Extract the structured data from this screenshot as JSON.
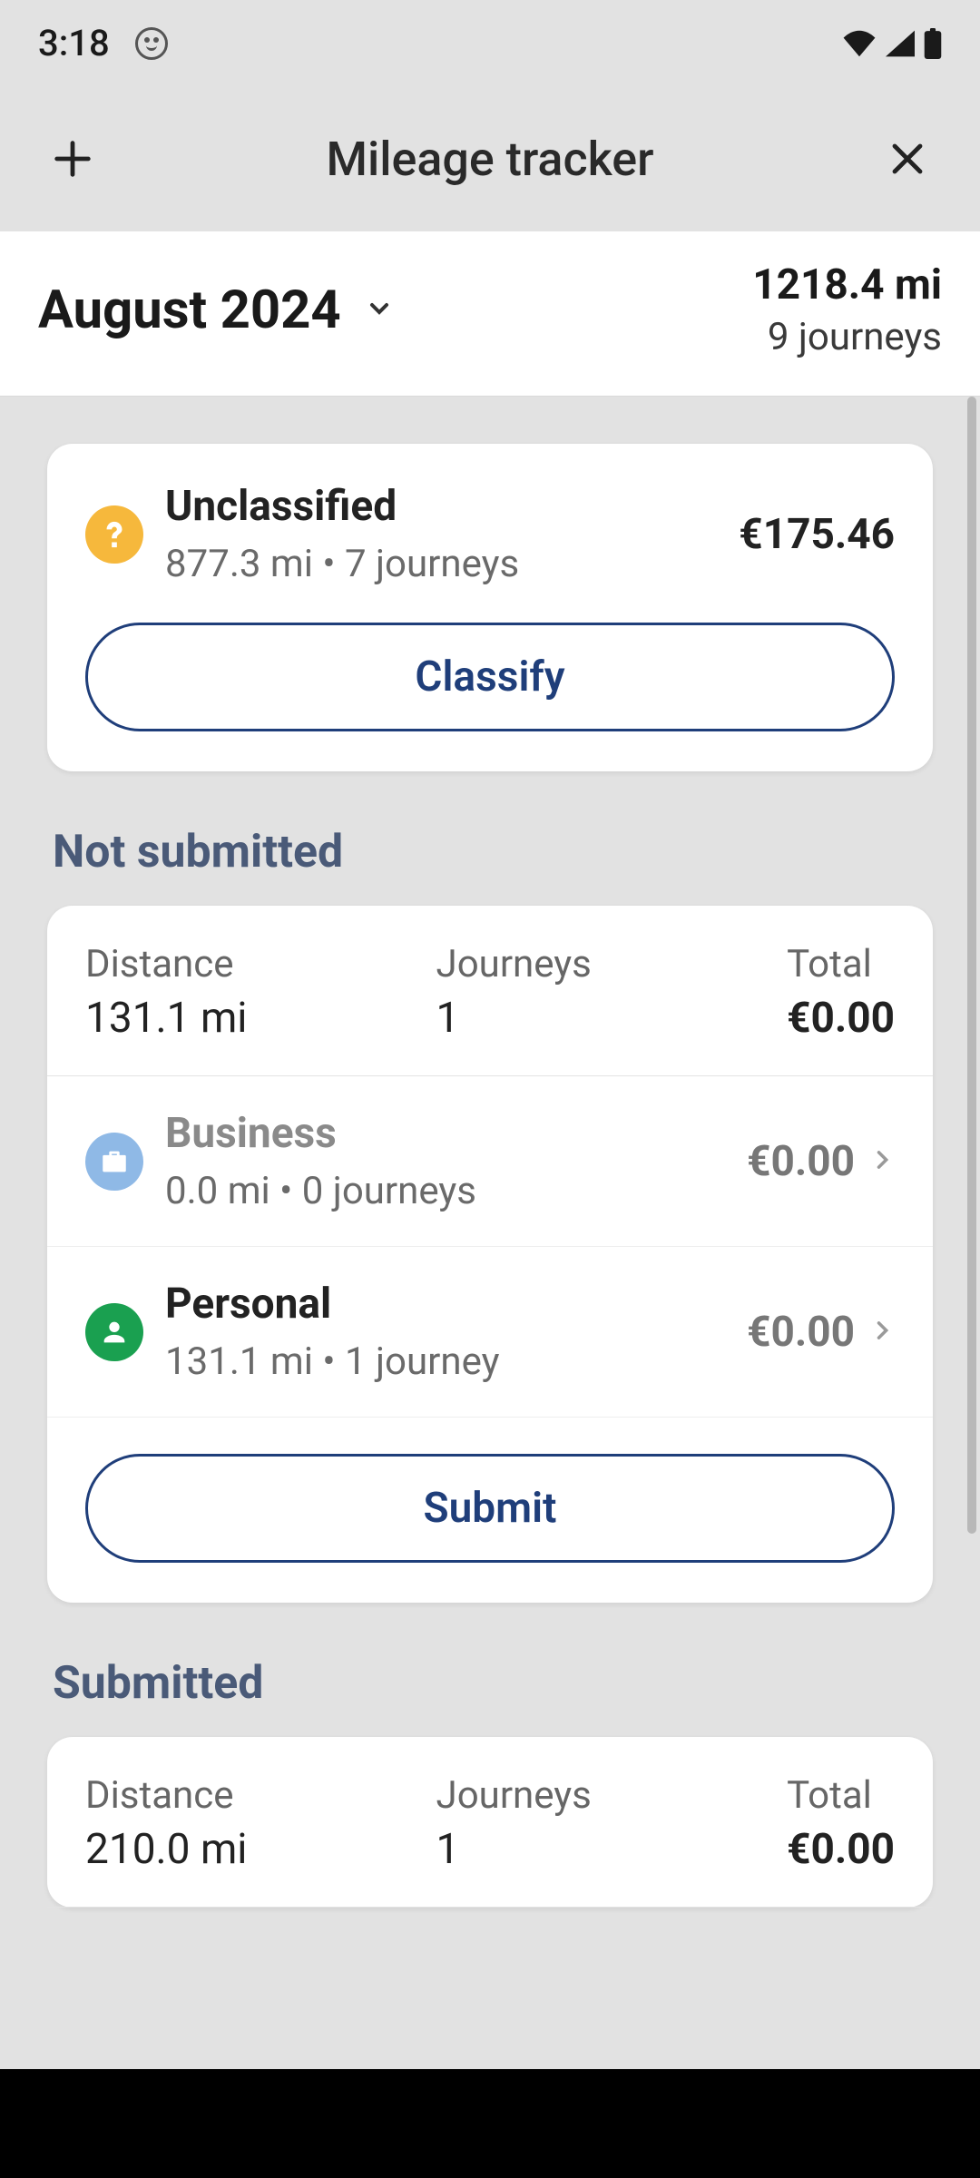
{
  "statusbar": {
    "time": "3:18"
  },
  "topbar": {
    "title": "Mileage tracker"
  },
  "summary": {
    "month": "August 2024",
    "total_distance": "1218.4 mi",
    "total_journeys": "9 journeys"
  },
  "unclassified": {
    "title": "Unclassified",
    "sub": "877.3 mi • 7 journeys",
    "amount": "€175.46",
    "button": "Classify"
  },
  "sections": {
    "not_submitted": {
      "heading": "Not submitted",
      "stats": {
        "distance_label": "Distance",
        "distance_value": "131.1 mi",
        "journeys_label": "Journeys",
        "journeys_value": "1",
        "total_label": "Total",
        "total_value": "€0.00"
      },
      "categories": [
        {
          "name": "Business",
          "sub": "0.0 mi • 0 journeys",
          "amount": "€0.00",
          "icon": "briefcase",
          "muted": true
        },
        {
          "name": "Personal",
          "sub": "131.1 mi • 1 journey",
          "amount": "€0.00",
          "icon": "person",
          "muted": false
        }
      ],
      "submit_button": "Submit"
    },
    "submitted": {
      "heading": "Submitted",
      "stats": {
        "distance_label": "Distance",
        "distance_value": "210.0 mi",
        "journeys_label": "Journeys",
        "journeys_value": "1",
        "total_label": "Total",
        "total_value": "€0.00"
      }
    }
  }
}
